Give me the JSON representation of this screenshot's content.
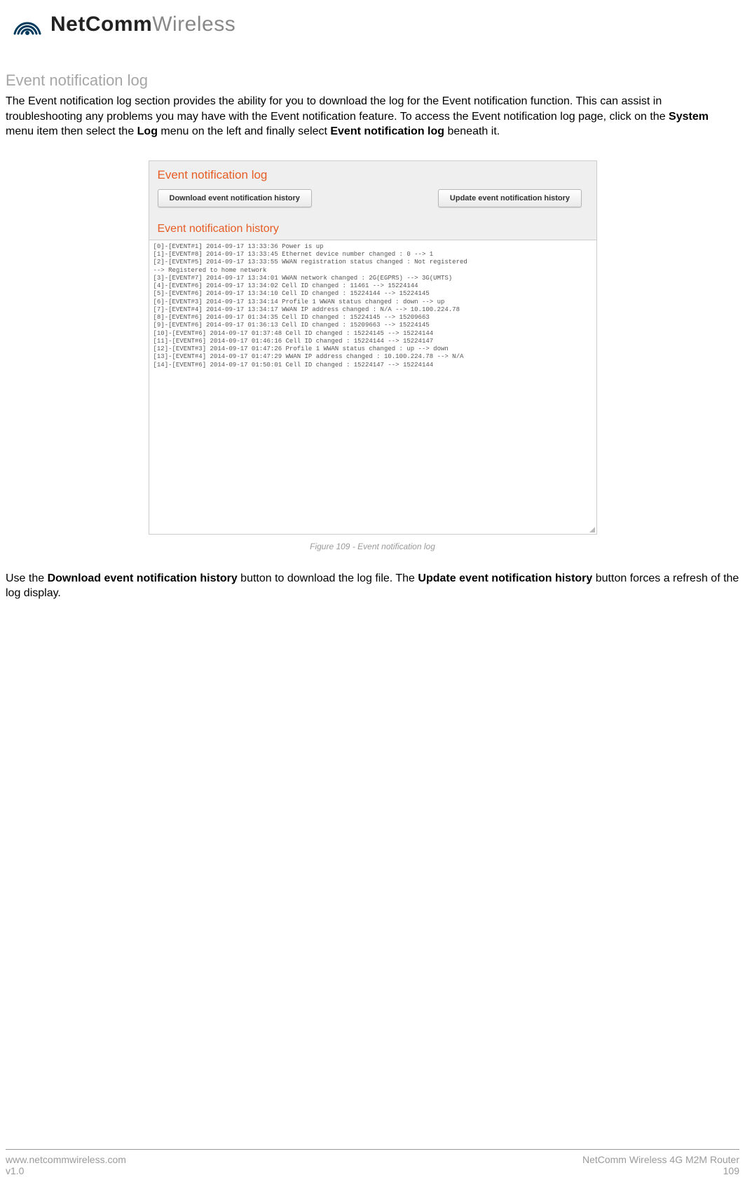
{
  "logo": {
    "bold": "NetComm",
    "light": "Wireless"
  },
  "heading": "Event notification log",
  "intro": {
    "p1a": "The Event notification log section provides the ability for you to download the log for the Event notification function. This can assist in troubleshooting any problems you may have with the Event notification feature. To access the Event notification log page, click on the ",
    "b1": "System",
    "p1b": " menu item then select the ",
    "b2": "Log",
    "p1c": " menu on the left and finally select ",
    "b3": "Event notification log",
    "p1d": " beneath it."
  },
  "panel": {
    "title": "Event notification log",
    "subtitle": "Event notification history",
    "buttons": {
      "download": "Download event notification history",
      "update": "Update event notification history"
    },
    "log_lines": [
      "[0]-[EVENT#1] 2014-09-17 13:33:36 Power is up",
      "[1]-[EVENT#8] 2014-09-17 13:33:45 Ethernet device number changed : 0 --> 1",
      "[2]-[EVENT#5] 2014-09-17 13:33:55 WWAN registration status changed : Not registered",
      "--> Registered to home network",
      "[3]-[EVENT#7] 2014-09-17 13:34:01 WWAN network changed : 2G(EGPRS) --> 3G(UMTS)",
      "[4]-[EVENT#6] 2014-09-17 13:34:02 Cell ID changed : 11461 --> 15224144",
      "[5]-[EVENT#6] 2014-09-17 13:34:10 Cell ID changed : 15224144 --> 15224145",
      "[6]-[EVENT#3] 2014-09-17 13:34:14 Profile 1 WWAN status changed : down --> up",
      "[7]-[EVENT#4] 2014-09-17 13:34:17 WWAN IP address changed : N/A --> 10.100.224.78",
      "[8]-[EVENT#6] 2014-09-17 01:34:35 Cell ID changed : 15224145 --> 15209663",
      "[9]-[EVENT#6] 2014-09-17 01:36:13 Cell ID changed : 15209663 --> 15224145",
      "[10]-[EVENT#6] 2014-09-17 01:37:48 Cell ID changed : 15224145 --> 15224144",
      "[11]-[EVENT#6] 2014-09-17 01:46:16 Cell ID changed : 15224144 --> 15224147",
      "[12]-[EVENT#3] 2014-09-17 01:47:26 Profile 1 WWAN status changed : up --> down",
      "[13]-[EVENT#4] 2014-09-17 01:47:29 WWAN IP address changed : 10.100.224.78 --> N/A",
      "[14]-[EVENT#6] 2014-09-17 01:50:01 Cell ID changed : 15224147 --> 15224144"
    ]
  },
  "figure_caption": "Figure 109 - Event notification log",
  "para2": {
    "a": "Use the ",
    "b1": "Download event notification history",
    "b": " button to download the log file. The ",
    "b2": "Update event notification history",
    "c": " button forces a refresh of the log display."
  },
  "footer": {
    "url": "www.netcommwireless.com",
    "version": "v1.0",
    "product": "NetComm Wireless 4G M2M Router",
    "page": "109"
  }
}
